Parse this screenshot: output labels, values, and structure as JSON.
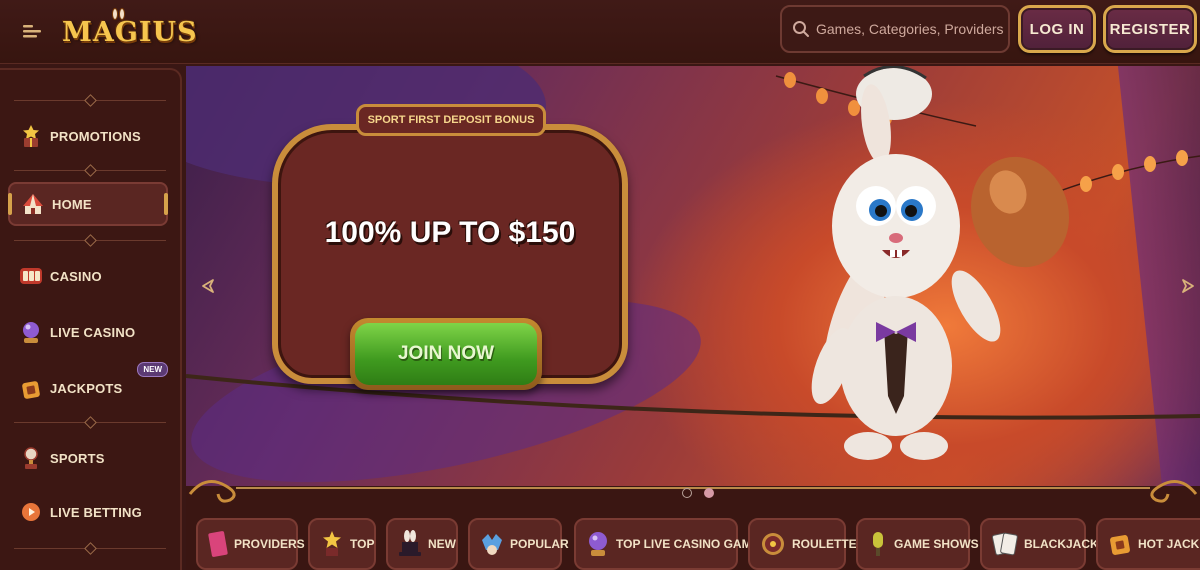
{
  "header": {
    "logo_text": "MAGIUS",
    "search_placeholder": "Games, Categories, Providers",
    "login_label": "LOG IN",
    "register_label": "REGISTER"
  },
  "sidebar": {
    "items": [
      {
        "label": "PROMOTIONS",
        "icon": "gift-box-icon"
      },
      {
        "label": "HOME",
        "icon": "circus-tent-icon"
      },
      {
        "label": "CASINO",
        "icon": "slot-reels-icon"
      },
      {
        "label": "LIVE CASINO",
        "icon": "crystal-ball-icon"
      },
      {
        "label": "JACKPOTS",
        "icon": "treasure-icon"
      },
      {
        "label": "SPORTS",
        "icon": "trophy-icon"
      },
      {
        "label": "LIVE BETTING",
        "icon": "live-ball-icon"
      }
    ],
    "new_badge": "NEW"
  },
  "hero": {
    "tab_label": "SPORT FIRST DEPOSIT BONUS",
    "title": "100% UP TO $150",
    "cta_label": "JOIN NOW",
    "slide_count": 2,
    "active_slide": 2
  },
  "categories": [
    {
      "label": "PROVIDERS",
      "icon": "book-icon"
    },
    {
      "label": "TOP",
      "icon": "star-hat-icon"
    },
    {
      "label": "NEW",
      "icon": "magic-hat-icon"
    },
    {
      "label": "POPULAR",
      "icon": "jester-icon"
    },
    {
      "label": "TOP LIVE CASINO GAMES",
      "icon": "crystal-ball-icon"
    },
    {
      "label": "ROULETTE",
      "icon": "roulette-icon"
    },
    {
      "label": "GAME SHOWS",
      "icon": "microphone-icon"
    },
    {
      "label": "BLACKJACK",
      "icon": "cards-icon"
    },
    {
      "label": "HOT JACKPOTS",
      "icon": "hot-treasure-icon"
    }
  ],
  "colors": {
    "background": "#3a1714",
    "accent_gold": "#d9a84c",
    "button_purple": "#6a2c45",
    "cta_green": "#4fae2a"
  }
}
